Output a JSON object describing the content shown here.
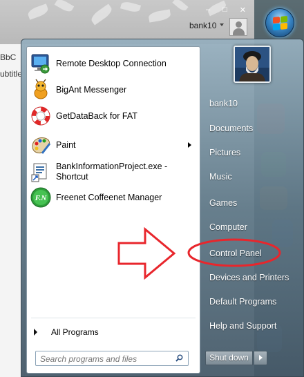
{
  "background_window": {
    "user_name": "bank10",
    "ribbon_style_text": "BbC",
    "ribbon_subtitle_text": "ubtitle"
  },
  "start_menu": {
    "programs": [
      {
        "label": "Remote Desktop Connection",
        "icon": "remote-desktop-icon"
      },
      {
        "label": "BigAnt Messenger",
        "icon": "ant-icon"
      },
      {
        "label": "GetDataBack for FAT",
        "icon": "lifebuoy-icon"
      },
      {
        "label": "Paint",
        "icon": "paint-palette-icon",
        "has_submenu": true
      },
      {
        "label": "BankInformationProject.exe - Shortcut",
        "line1": "BankInformationProject.exe -",
        "line2": "Shortcut",
        "icon": "application-icon"
      },
      {
        "label": "Freenet Coffeenet Manager",
        "icon": "freenet-icon"
      }
    ],
    "all_programs_label": "All Programs",
    "search_placeholder": "Search programs and files",
    "right_items": [
      {
        "label": "bank10"
      },
      {
        "label": "Documents"
      },
      {
        "label": "Pictures"
      },
      {
        "label": "Music"
      },
      {
        "label": "Games"
      },
      {
        "label": "Computer"
      },
      {
        "label": "Control Panel",
        "highlighted": true
      },
      {
        "label": "Devices and Printers"
      },
      {
        "label": "Default Programs"
      },
      {
        "label": "Help and Support"
      }
    ],
    "shutdown_label": "Shut down"
  },
  "annotations": {
    "arrow_color": "#e8262c",
    "circle_color": "#e8262c",
    "circled_item": "Control Panel"
  },
  "colors": {
    "orb_blue": "#3a88c8",
    "menu_glass": "#5f7887"
  }
}
